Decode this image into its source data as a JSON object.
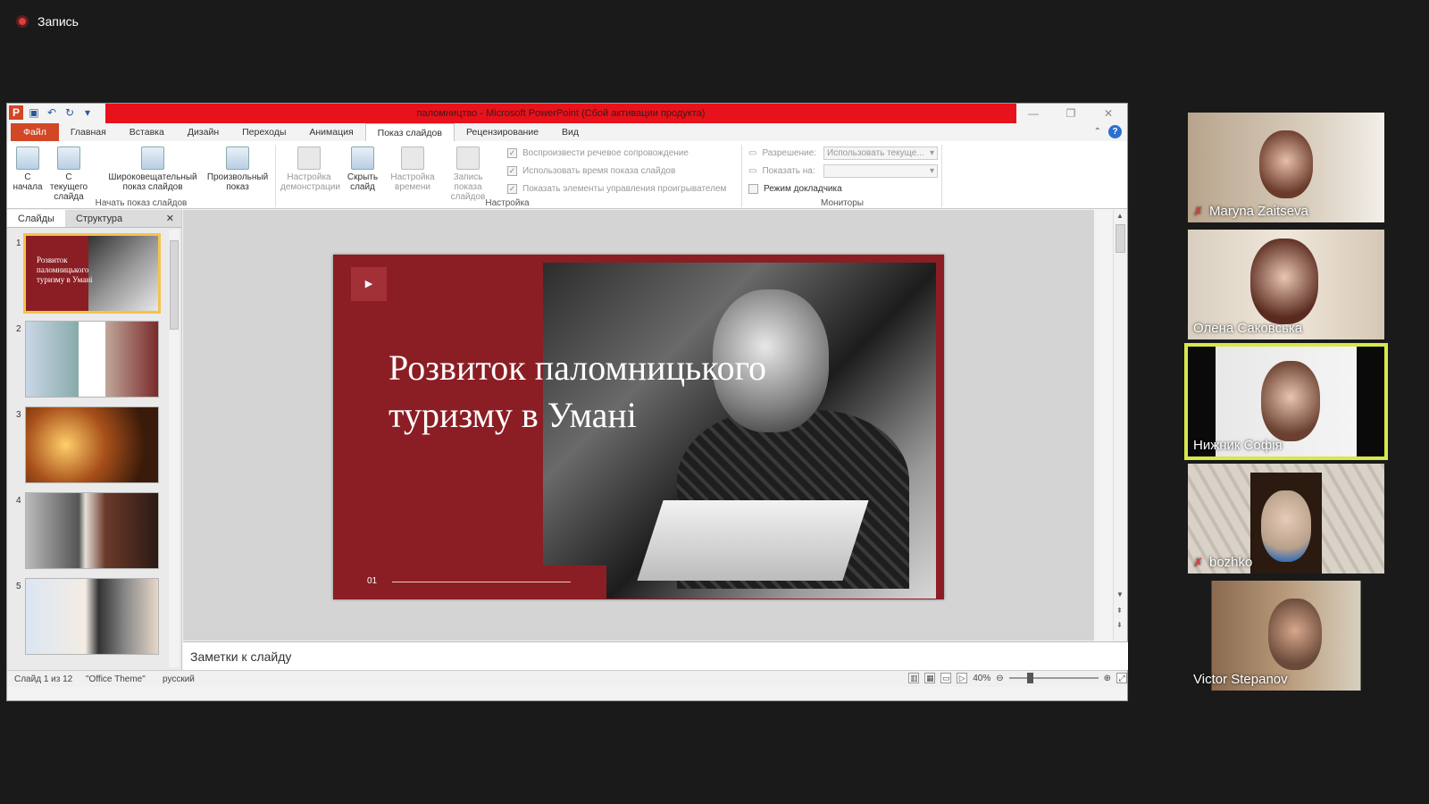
{
  "recording": {
    "label": "Запись"
  },
  "window": {
    "title": "паломництво  -  Microsoft PowerPoint (Сбой активации продукта)",
    "tabs": [
      "Файл",
      "Главная",
      "Вставка",
      "Дизайн",
      "Переходы",
      "Анимация",
      "Показ слайдов",
      "Рецензирование",
      "Вид"
    ],
    "active_tab": "Показ слайдов"
  },
  "ribbon": {
    "from_start": "С начала",
    "from_current": "С текущего слайда",
    "broadcast": "Широковещательный показ слайдов",
    "custom": "Произвольный показ",
    "group_start": "Начать показ слайдов",
    "setup": "Настройка демонстрации",
    "hide": "Скрыть слайд",
    "rehearse": "Настройка времени",
    "record": "Запись показа слайдов",
    "chk_narration": "Воспроизвести речевое сопровождение",
    "chk_timings": "Использовать время показа слайдов",
    "chk_controls": "Показать элементы управления проигрывателем",
    "group_setup": "Настройка",
    "resolution_label": "Разрешение:",
    "resolution_value": "Использовать текуще...",
    "show_on_label": "Показать на:",
    "presenter_view": "Режим докладчика",
    "group_monitors": "Мониторы"
  },
  "left_pane": {
    "tab_slides": "Слайды",
    "tab_outline": "Структура",
    "close": "✕"
  },
  "thumb_numbers": [
    "1",
    "2",
    "3",
    "4",
    "5"
  ],
  "slide": {
    "title": "Розвиток паломницького туризму в Умані",
    "page": "01",
    "thumb_title": "Розвиток паломницького туризму в Умані"
  },
  "notes_placeholder": "Заметки к слайду",
  "status": {
    "slide": "Слайд 1 из 12",
    "theme": "\"Office Theme\"",
    "language": "русский",
    "zoom": "40%"
  },
  "participants": [
    {
      "name": "Maryna Zaitseva",
      "muted": true
    },
    {
      "name": "Олена Саковська",
      "muted": false
    },
    {
      "name": "Нижник Софія",
      "muted": false,
      "active": true
    },
    {
      "name": "bozhko",
      "muted": true
    },
    {
      "name": "Victor Stepanov",
      "muted": false
    }
  ],
  "colors": {
    "ppt_red": "#e8121c",
    "file_tab": "#d24726",
    "slide_red": "#8b1e24",
    "speaker_border": "#d8e84a"
  }
}
